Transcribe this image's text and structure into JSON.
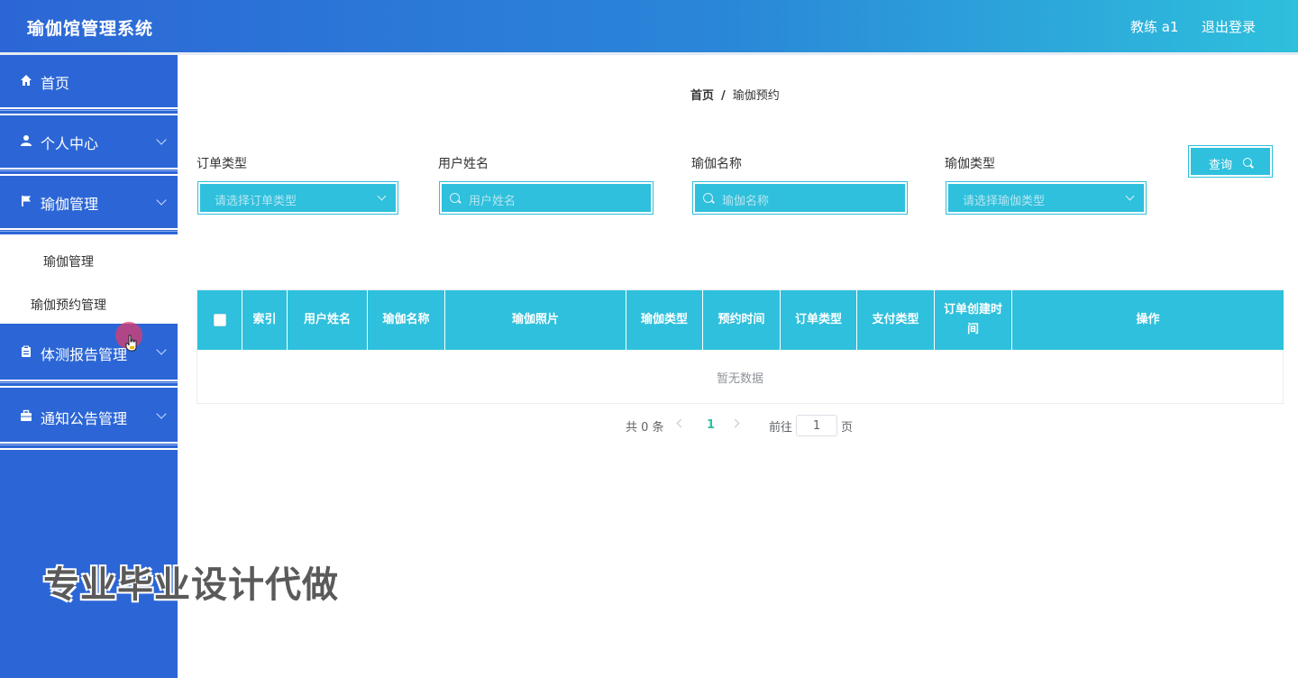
{
  "header": {
    "title": "瑜伽馆管理系统",
    "user": "教练 a1",
    "logout": "退出登录"
  },
  "sidebar": {
    "items": [
      {
        "label": "首页",
        "icon": "home-icon"
      },
      {
        "label": "个人中心",
        "icon": "user-icon"
      },
      {
        "label": "瑜伽管理",
        "icon": "flag-icon"
      },
      {
        "label": "体测报告管理",
        "icon": "clipboard-icon"
      },
      {
        "label": "通知公告管理",
        "icon": "briefcase-icon"
      }
    ],
    "submenu": [
      "瑜伽管理",
      "瑜伽预约管理"
    ]
  },
  "breadcrumb": {
    "home": "首页",
    "separator": "/",
    "current": "瑜伽预约"
  },
  "search": {
    "order_type": {
      "label": "订单类型",
      "placeholder": "请选择订单类型"
    },
    "user_name": {
      "label": "用户姓名",
      "placeholder": "用户姓名"
    },
    "yoga_name": {
      "label": "瑜伽名称",
      "placeholder": "瑜伽名称"
    },
    "yoga_type": {
      "label": "瑜伽类型",
      "placeholder": "请选择瑜伽类型"
    },
    "query_button": "查询"
  },
  "table": {
    "columns": [
      "索引",
      "用户姓名",
      "瑜伽名称",
      "瑜伽照片",
      "瑜伽类型",
      "预约时间",
      "订单类型",
      "支付类型",
      "订单创建时间",
      "操作"
    ],
    "empty_text": "暂无数据"
  },
  "pagination": {
    "total": "共 0 条",
    "current_page": "1",
    "goto_prefix": "前往",
    "goto_value": "1",
    "goto_suffix": "页"
  },
  "watermark": "专业毕业设计代做",
  "colors": {
    "sidebar": "#2c66d6",
    "accent": "#2ec0dc",
    "header_start": "#2c66d6",
    "header_end": "#2ec0dc"
  }
}
